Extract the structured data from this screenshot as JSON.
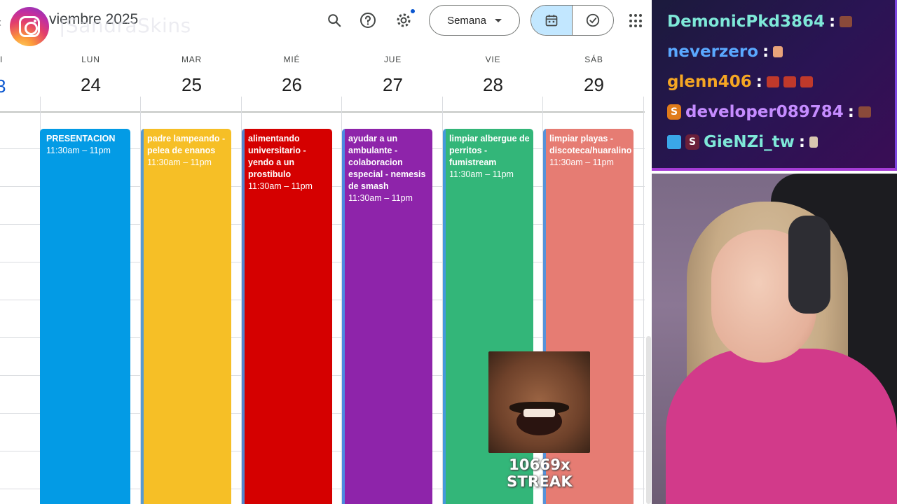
{
  "calendar": {
    "month_title": "viembre 2025",
    "watermark": "|SandraSkins",
    "view_select": "Semana",
    "left_day_name": "I",
    "left_day_num": "3",
    "days": [
      {
        "name": "LUN",
        "num": "24"
      },
      {
        "name": "MAR",
        "num": "25"
      },
      {
        "name": "MIÉ",
        "num": "26"
      },
      {
        "name": "JUE",
        "num": "27"
      },
      {
        "name": "VIE",
        "num": "28"
      },
      {
        "name": "SÁB",
        "num": "29"
      }
    ],
    "events": [
      {
        "title": "PRESENTACION",
        "time": "11:30am – 11pm",
        "color": "#039be5",
        "text_color": "#ffffff"
      },
      {
        "title": "padre lampeando - pelea de enanos",
        "time": "11:30am – 11pm",
        "color": "#f6bf26",
        "text_color": "#ffffff"
      },
      {
        "title": "alimentando universitario - yendo a un prostibulo",
        "time": "11:30am – 11pm",
        "color": "#d50000",
        "text_color": "#ffffff"
      },
      {
        "title": "ayudar a un ambulante - colaboracion especial - nemesis de smash",
        "time": "11:30am – 11pm",
        "color": "#8e24aa",
        "text_color": "#ffffff"
      },
      {
        "title": "limpiar albergue de perritos - fumistream",
        "time": "11:30am – 11pm",
        "color": "#33b679",
        "text_color": "#ffffff"
      },
      {
        "title": "limpiar playas - discoteca/huaralino",
        "time": "11:30am – 11pm",
        "color": "#e67c73",
        "text_color": "#ffffff"
      }
    ]
  },
  "chat": {
    "messages": [
      {
        "user": "DemonicPkd3864",
        "color": "#7ee8d8",
        "emotes": 1
      },
      {
        "user": "neverzero",
        "color": "#5aa8ff",
        "emotes": 1
      },
      {
        "user": "glenn406",
        "color": "#f5a623",
        "emotes": 3
      },
      {
        "user": "developer089784",
        "color": "#c58cff",
        "emotes": 1,
        "badge": "S"
      },
      {
        "user": "GieNZi_tw",
        "color": "#7ee8d8",
        "emotes": 1,
        "badge": "S"
      }
    ],
    "separator": ":"
  },
  "overlay": {
    "streak_text": "10669x STREAK"
  }
}
